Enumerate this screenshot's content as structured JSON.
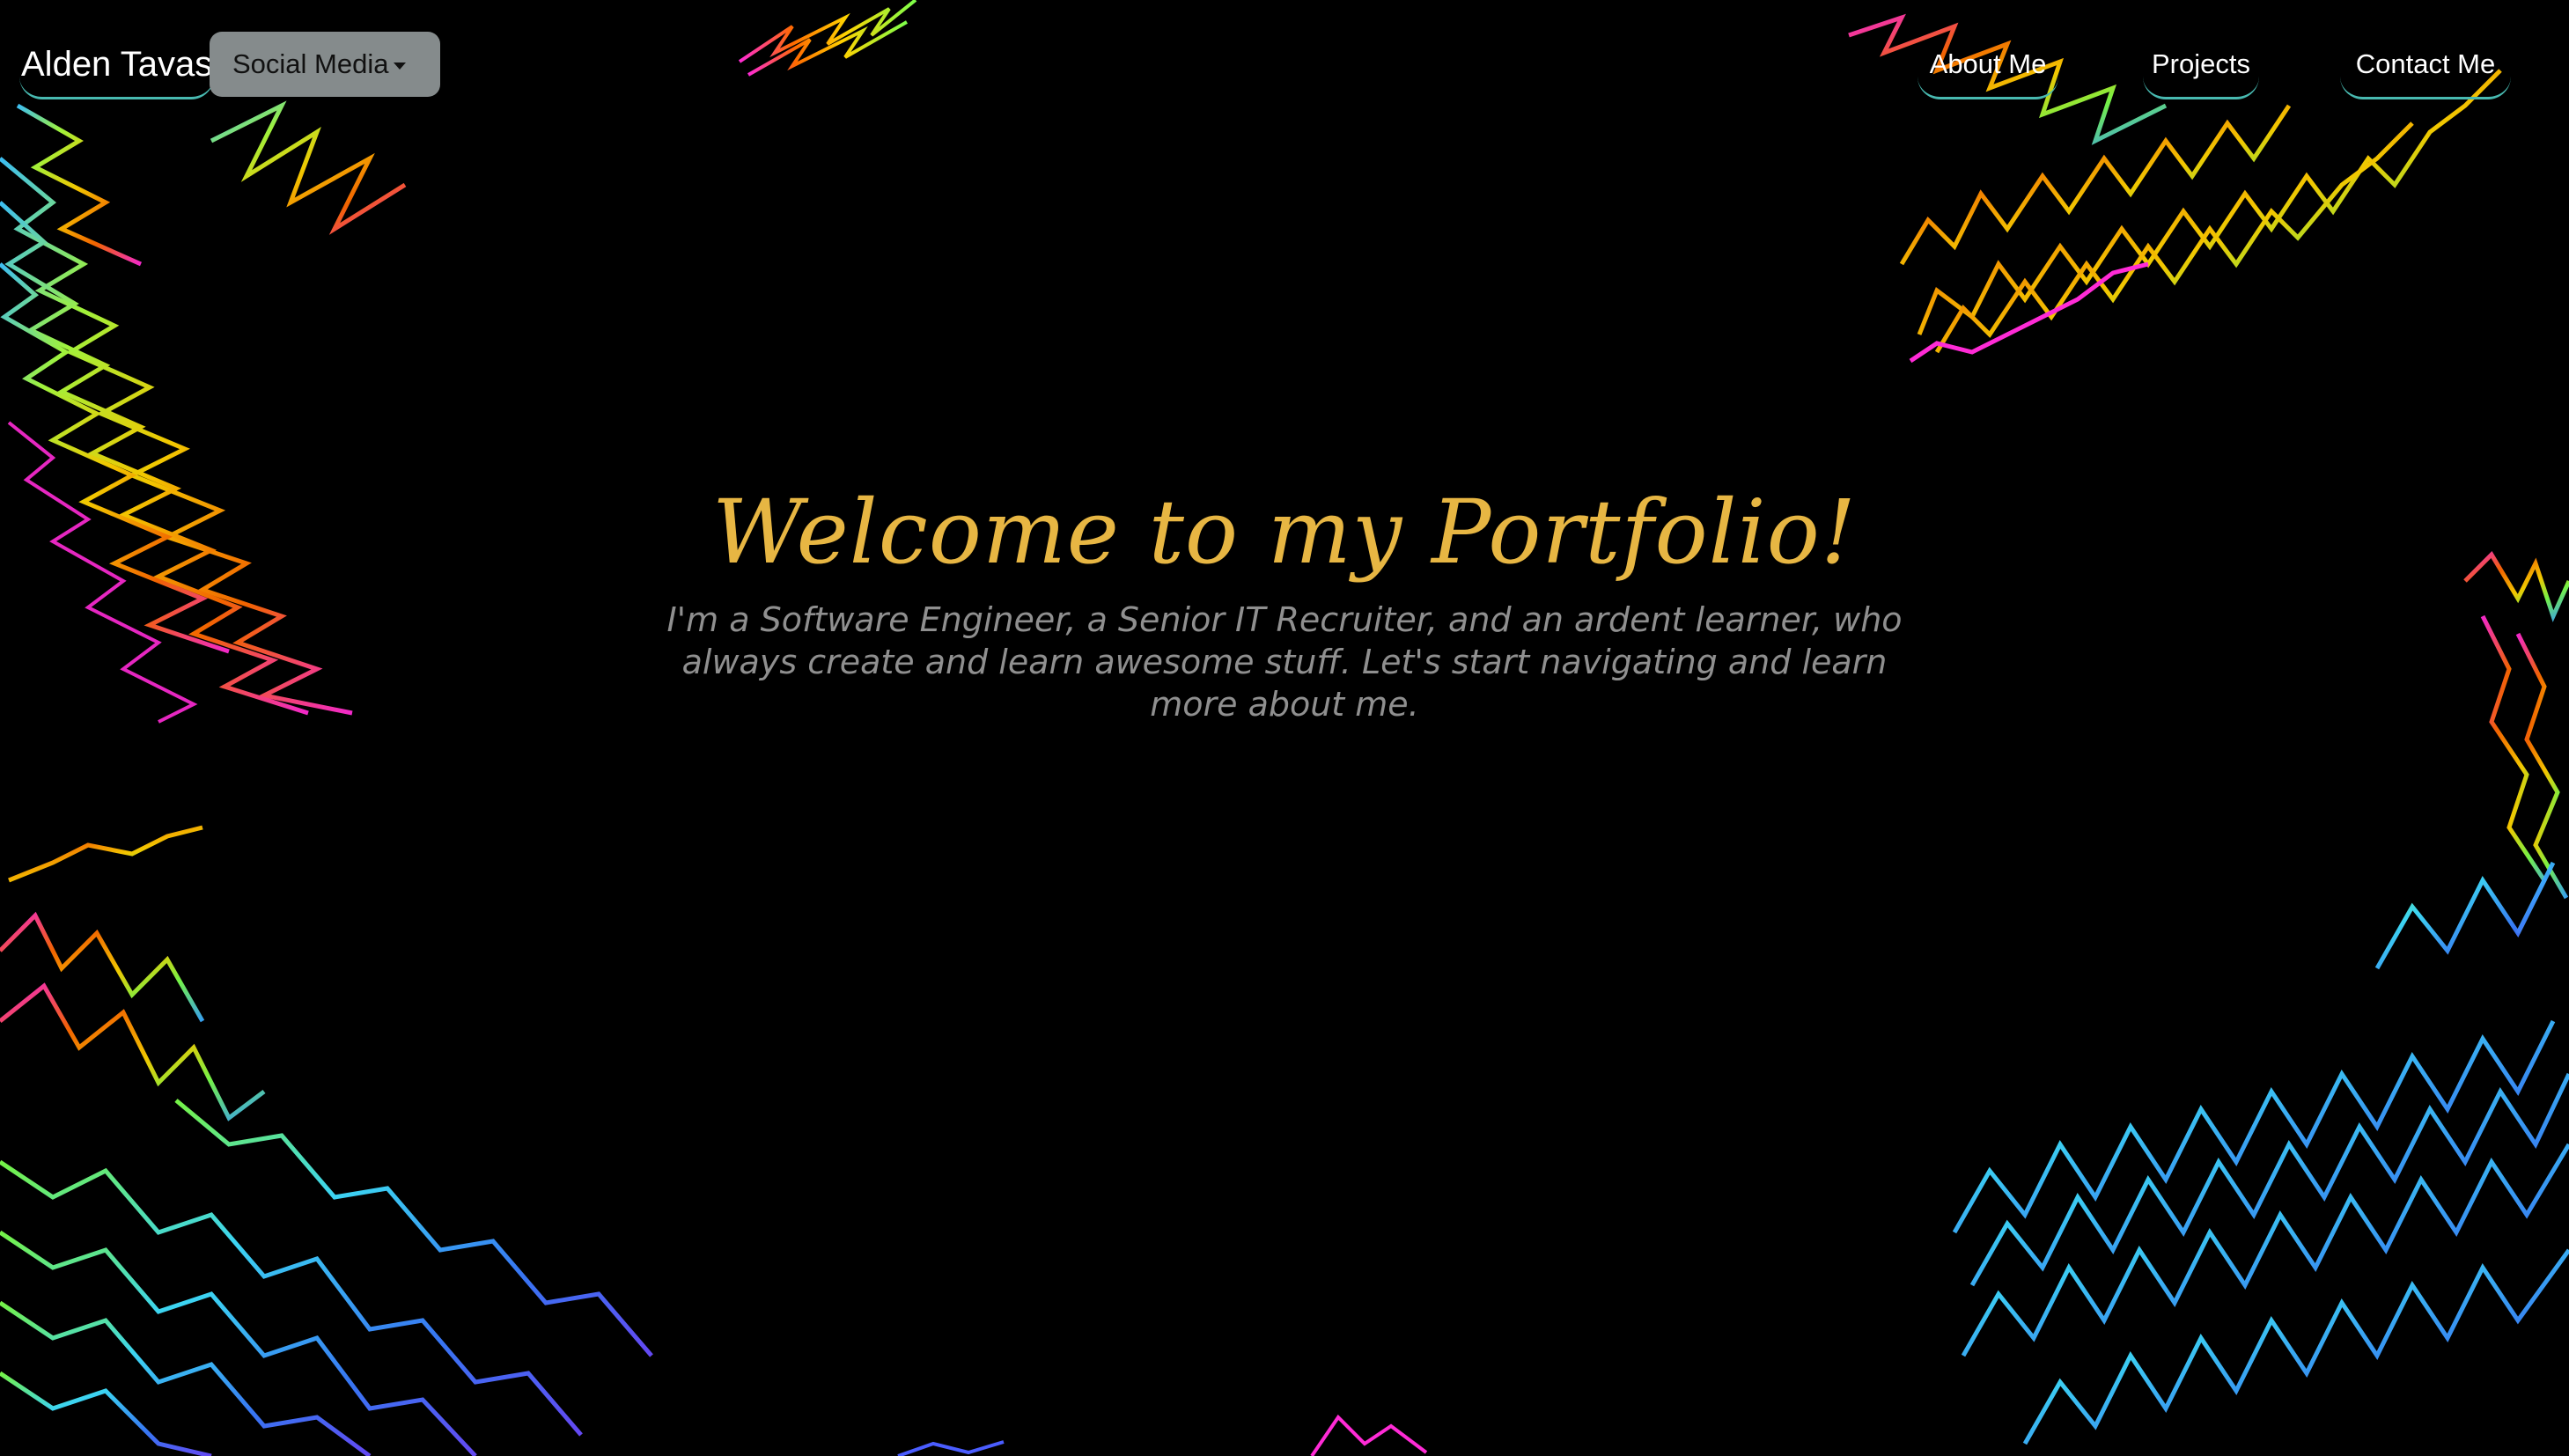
{
  "navbar": {
    "brand": "Alden Tavas",
    "dropdown_label": "Social Media",
    "links": [
      "About Me",
      "Projects",
      "Contact Me"
    ]
  },
  "hero": {
    "title": "Welcome to my Portfolio!",
    "subtitle": "I'm a Software Engineer, a Senior IT Recruiter, and an ardent learner, who always create and learn awesome stuff. Let's start navigating and learn more about me."
  },
  "icons": {
    "dropdown": "chevron-down-icon"
  },
  "colors": {
    "background": "#000000",
    "title": "#e7b643",
    "subtitle": "#8f8f8f",
    "nav_text": "#ffffff",
    "nav_underline": "#48b9b0",
    "dropdown_bg": "#858b8c"
  }
}
